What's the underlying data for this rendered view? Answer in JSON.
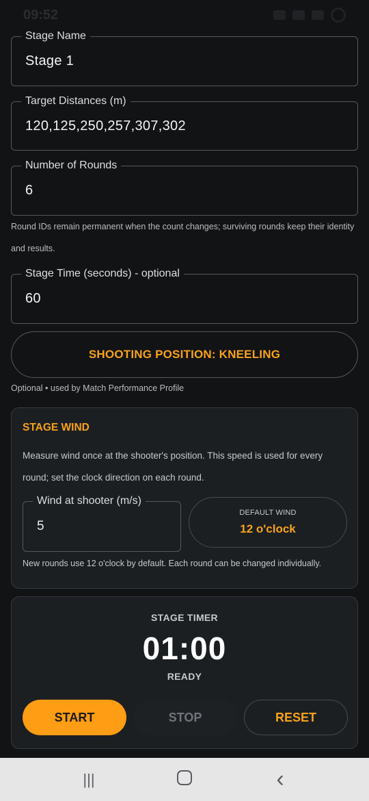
{
  "status_bar": {
    "time": "09:52"
  },
  "fields": {
    "stage_name": {
      "label": "Stage Name",
      "value": "Stage 1"
    },
    "target_distances": {
      "label": "Target Distances (m)",
      "value": "120,125,250,257,307,302"
    },
    "number_of_rounds": {
      "label": "Number of Rounds",
      "value": "6"
    },
    "rounds_hint": "Round IDs remain permanent when the count changes; surviving rounds keep their identity and results.",
    "stage_time": {
      "label": "Stage Time (seconds) - optional",
      "value": "60"
    }
  },
  "shooting_position": {
    "label": "SHOOTING POSITION: KNEELING",
    "hint": "Optional • used by Match Performance Profile"
  },
  "stage_wind": {
    "title": "STAGE WIND",
    "description": "Measure wind once at the shooter's position. This speed is used for every round; set the clock direction on each round.",
    "wind_field": {
      "label": "Wind at shooter (m/s)",
      "value": "5"
    },
    "default_wind_caption": "DEFAULT WIND",
    "default_wind_value": "12 o'clock",
    "note": "New rounds use 12 o'clock by default. Each round can be changed individually."
  },
  "stage_timer": {
    "title": "STAGE TIMER",
    "time": "01:00",
    "state": "READY",
    "start_label": "START",
    "stop_label": "STOP",
    "reset_label": "RESET"
  },
  "nav": {
    "recents": "|||",
    "back": "‹"
  },
  "colors": {
    "accent": "#f7a21b",
    "background": "#121314",
    "card": "#1c1f22"
  }
}
